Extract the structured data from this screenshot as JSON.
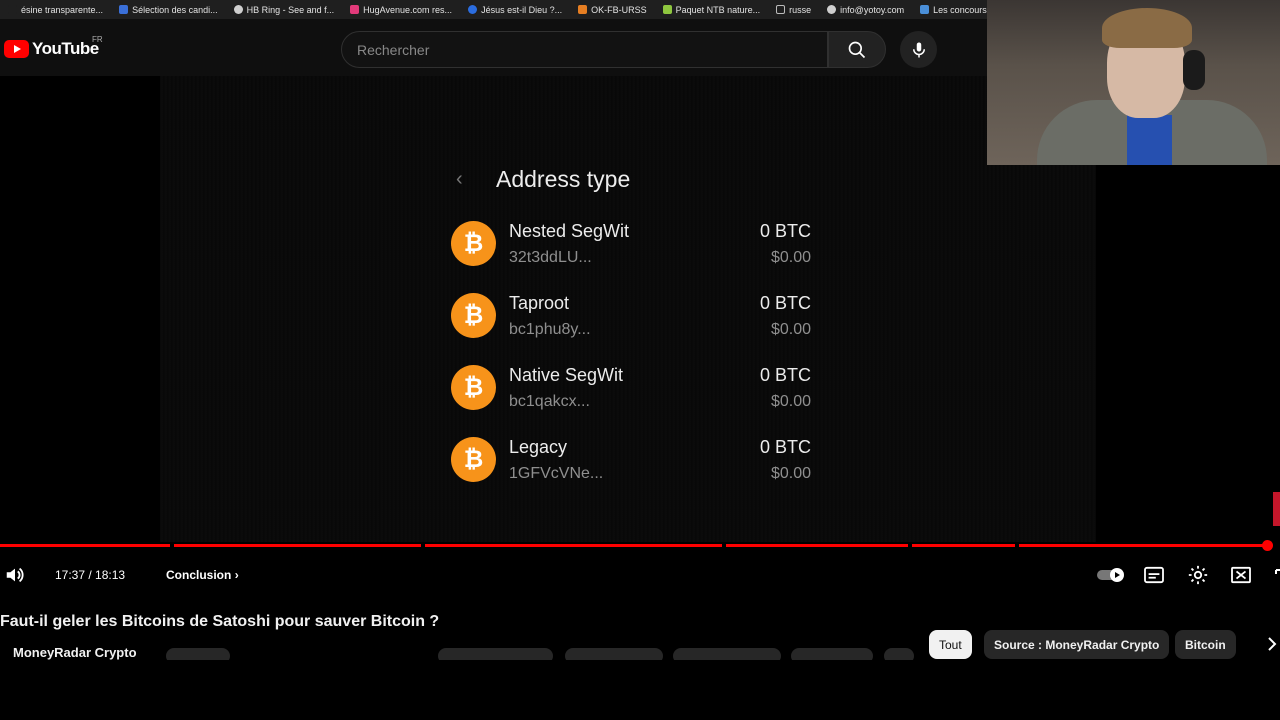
{
  "bookmarks": [
    {
      "label": "ésine transparente...",
      "color": "#1f1f1f"
    },
    {
      "label": "Sélection des candi...",
      "color": "#3a6fd8"
    },
    {
      "label": "HB Ring - See and f...",
      "color": "#cfcfcf"
    },
    {
      "label": "HugAvenue.com res...",
      "color": "#e23a7a"
    },
    {
      "label": "Jésus est-il Dieu ?...",
      "color": "#2b6de0"
    },
    {
      "label": "OK-FB-URSS",
      "color": "#e67e22"
    },
    {
      "label": "Paquet NTB nature...",
      "color": "#8ec63f"
    },
    {
      "label": "russe",
      "color": "#9e9e9e"
    },
    {
      "label": "info@yotoy.com",
      "color": "#cfcfcf"
    },
    {
      "label": "Les concours d'aute...",
      "color": "#4a8fd8"
    }
  ],
  "header": {
    "logo_text": "YouTube",
    "region": "FR",
    "search_placeholder": "Rechercher"
  },
  "wallet": {
    "title": "Address type",
    "rows": [
      {
        "name": "Nested SegWit",
        "address": "32t3ddLU...",
        "btc": "0 BTC",
        "usd": "$0.00"
      },
      {
        "name": "Taproot",
        "address": "bc1phu8y...",
        "btc": "0 BTC",
        "usd": "$0.00"
      },
      {
        "name": "Native SegWit",
        "address": "bc1qakcx...",
        "btc": "0 BTC",
        "usd": "$0.00"
      },
      {
        "name": "Legacy",
        "address": "1GFVcVNe...",
        "btc": "0 BTC",
        "usd": "$0.00"
      }
    ]
  },
  "player": {
    "time": "17:37 / 18:13",
    "chapter": "Conclusion",
    "progress": 0.968,
    "accent": "#ff0000"
  },
  "video": {
    "title": "Faut-il geler les Bitcoins de Satoshi pour sauver Bitcoin ?",
    "channel": "MoneyRadar Crypto"
  },
  "chips": [
    {
      "label": "Tout",
      "active": true
    },
    {
      "label": "Source : MoneyRadar Crypto",
      "active": false
    },
    {
      "label": "Bitcoin",
      "active": false
    }
  ]
}
